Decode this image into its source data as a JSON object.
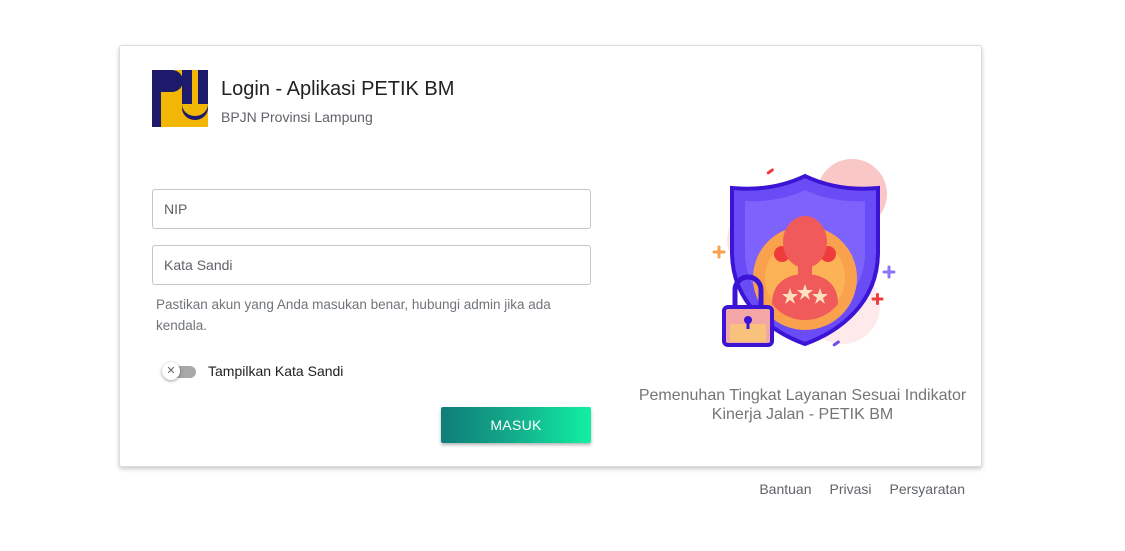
{
  "header": {
    "title": "Login - Aplikasi PETIK BM",
    "subtitle": "BPJN Provinsi Lampung",
    "logo_icon": "pupr-logo"
  },
  "form": {
    "nip_placeholder": "NIP",
    "password_placeholder": "Kata Sandi",
    "hint": "Pastikan akun yang Anda masukan benar, hubungi admin jika ada kendala.",
    "show_password_label": "Tampilkan Kata Sandi",
    "show_password_on": false,
    "submit_label": "MASUK"
  },
  "illustration": {
    "icon": "security-shield-lock-illustration",
    "caption": "Pemenuhan Tingkat Layanan Sesuai Indikator Kinerja Jalan - PETIK BM"
  },
  "footer": {
    "links": [
      "Bantuan",
      "Privasi",
      "Persyaratan"
    ]
  },
  "colors": {
    "button_gradient_start": "#0f7d78",
    "button_gradient_end": "#12f0a2",
    "shield": "#6a4cf6",
    "logo_yellow": "#f2b705",
    "logo_navy": "#1e1a6b"
  }
}
